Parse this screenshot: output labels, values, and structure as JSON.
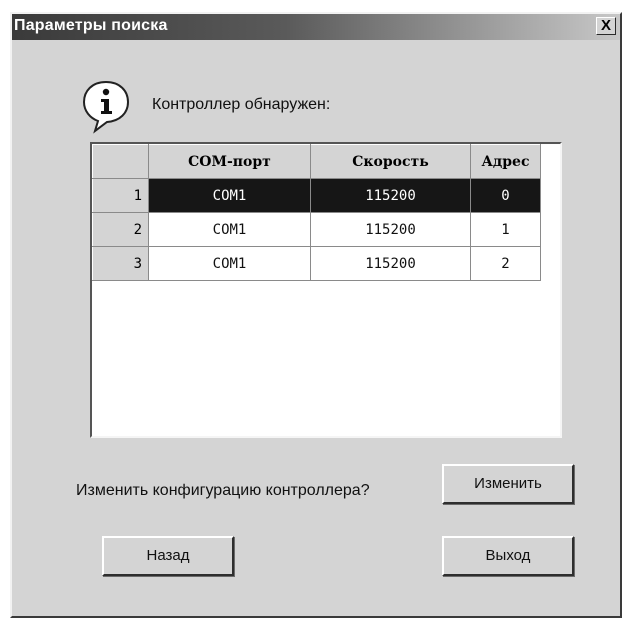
{
  "window": {
    "title": "Параметры поиска",
    "close_symbol": "X"
  },
  "message": {
    "icon": "info-icon",
    "text": "Контроллер обнаружен:"
  },
  "table": {
    "headers": [
      "",
      "COM-порт",
      "Скорость",
      "Адрес"
    ],
    "rows": [
      {
        "num": "1",
        "port": "COM1",
        "speed": "115200",
        "address": "0",
        "selected": true
      },
      {
        "num": "2",
        "port": "COM1",
        "speed": "115200",
        "address": "1",
        "selected": false
      },
      {
        "num": "3",
        "port": "COM1",
        "speed": "115200",
        "address": "2",
        "selected": false
      }
    ]
  },
  "question": "Изменить конфигурацию контроллера?",
  "buttons": {
    "change": "Изменить",
    "back": "Назад",
    "exit": "Выход"
  },
  "colors": {
    "selected_row_bg": "#161616",
    "selected_row_text": "#ffffff",
    "dialog_bg": "#d4d4d4"
  }
}
